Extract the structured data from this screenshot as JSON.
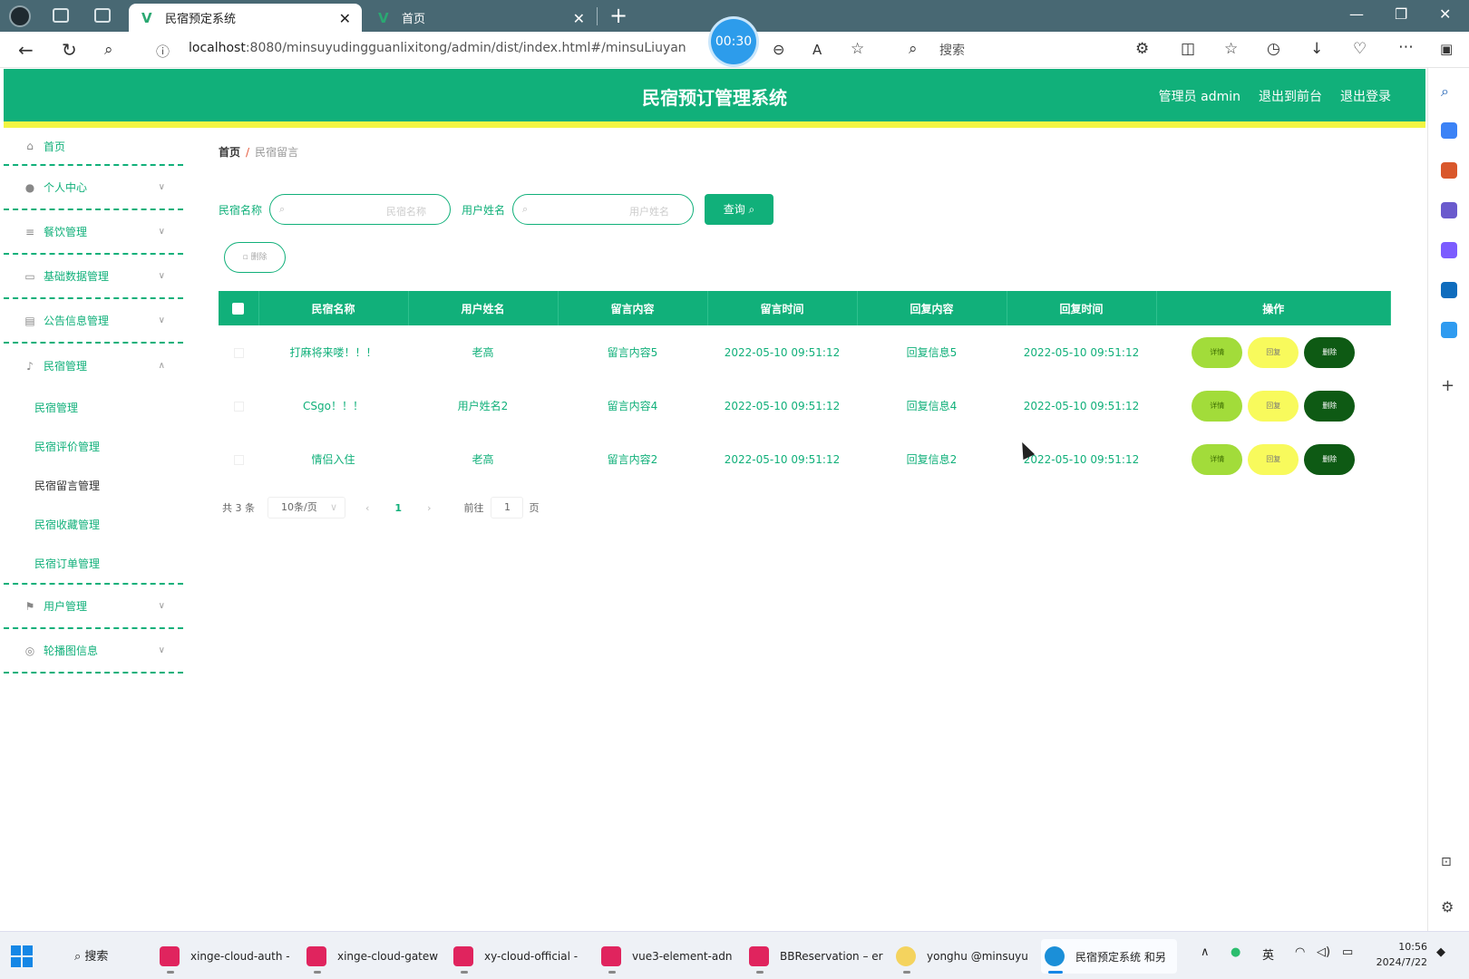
{
  "browser": {
    "tabs": [
      {
        "title": "民宿预定系统",
        "active": true
      },
      {
        "title": "首页",
        "active": false
      }
    ],
    "url_host": "localhost",
    "url_rest": ":8080/minsuyudingguanlixitong/admin/dist/index.html#/minsuLiuyan",
    "timer": "00:30",
    "search_placeholder": "搜索"
  },
  "app": {
    "title": "民宿预订管理系统",
    "header_links": [
      "管理员 admin",
      "退出到前台",
      "退出登录"
    ],
    "colors": {
      "primary": "#11b07a",
      "accent_line": "#f3f542",
      "detail_btn": "#a2dc3a",
      "reply_btn": "#f8fa5c",
      "delete_btn": "#0e5a14"
    }
  },
  "sidebar": {
    "items": [
      {
        "label": "首页",
        "icon": "home-icon",
        "expandable": false
      },
      {
        "label": "个人中心",
        "icon": "user-icon",
        "expandable": true
      },
      {
        "label": "餐饮管理",
        "icon": "sliders-icon",
        "expandable": true
      },
      {
        "label": "基础数据管理",
        "icon": "card-icon",
        "expandable": true
      },
      {
        "label": "公告信息管理",
        "icon": "clipboard-icon",
        "expandable": true
      },
      {
        "label": "民宿管理",
        "icon": "microphone-icon",
        "expandable": true,
        "expanded": true,
        "children": [
          "民宿管理",
          "民宿评价管理",
          "民宿留言管理",
          "民宿收藏管理",
          "民宿订单管理"
        ]
      },
      {
        "label": "用户管理",
        "icon": "flag-icon",
        "expandable": true
      },
      {
        "label": "轮播图信息",
        "icon": "settings-circle-icon",
        "expandable": true
      }
    ],
    "active_child": "民宿留言管理"
  },
  "breadcrumb": {
    "home": "首页",
    "current": "民宿留言"
  },
  "filters": {
    "name_label": "民宿名称",
    "name_placeholder": "民宿名称",
    "user_label": "用户姓名",
    "user_placeholder": "用户姓名",
    "query_button": "查询"
  },
  "delete_button": "删除",
  "table": {
    "headers": [
      "民宿名称",
      "用户姓名",
      "留言内容",
      "留言时间",
      "回复内容",
      "回复时间",
      "操作"
    ],
    "rows": [
      [
        "打麻将来喽！！！",
        "老高",
        "留言内容5",
        "2022-05-10 09:51:12",
        "回复信息5",
        "2022-05-10 09:51:12"
      ],
      [
        "CSgo！！！",
        "用户姓名2",
        "留言内容4",
        "2022-05-10 09:51:12",
        "回复信息4",
        "2022-05-10 09:51:12"
      ],
      [
        "情侣入住",
        "老高",
        "留言内容2",
        "2022-05-10 09:51:12",
        "回复信息2",
        "2022-05-10 09:51:12"
      ]
    ],
    "row_actions": [
      "详情",
      "回复",
      "删除"
    ]
  },
  "pagination": {
    "total": "共 3 条",
    "page_size": "10条/页",
    "current_page": "1",
    "goto_label": "前往",
    "goto_value": "1",
    "page_unit": "页"
  },
  "taskbar": {
    "search": "搜索",
    "apps": [
      "xinge-cloud-auth -",
      "xinge-cloud-gatew",
      "xy-cloud-official -",
      "vue3-element-adn",
      "BBReservation – er",
      "yonghu @minsuyu",
      "民宿预定系统 和另"
    ],
    "ime": "英",
    "time": "10:56",
    "date": "2024/7/22"
  }
}
